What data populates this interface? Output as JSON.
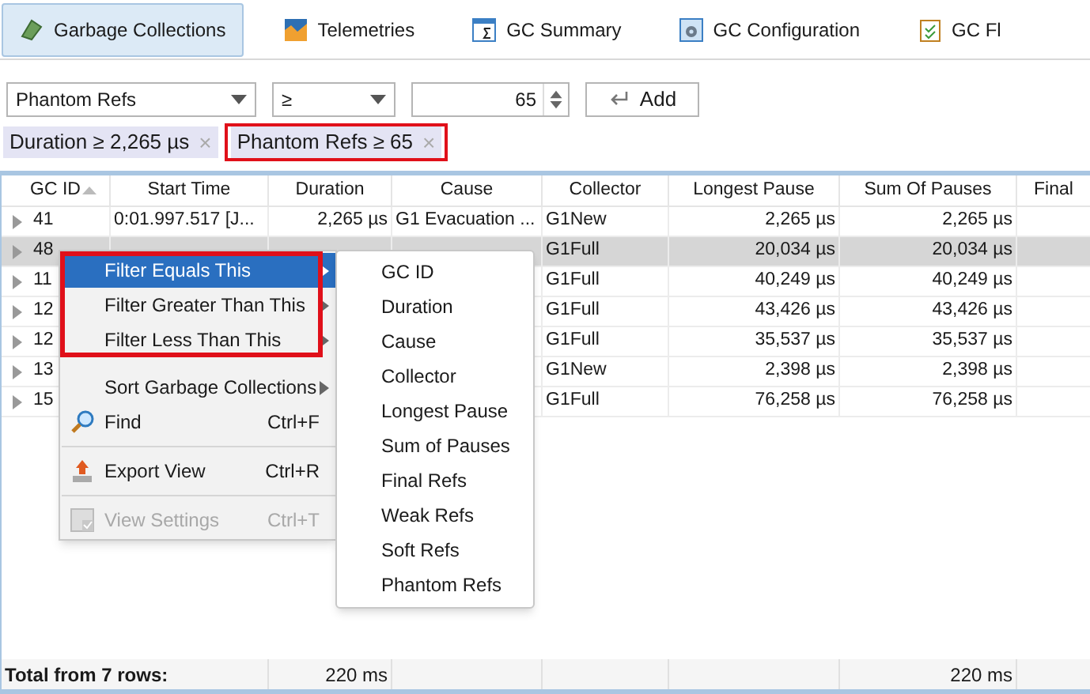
{
  "tabs": [
    {
      "label": "Garbage Collections",
      "selected": true
    },
    {
      "label": "Telemetries",
      "selected": false
    },
    {
      "label": "GC Summary",
      "selected": false
    },
    {
      "label": "GC Configuration",
      "selected": false
    },
    {
      "label": "GC Fl",
      "selected": false
    }
  ],
  "filter_bar": {
    "attribute": "Phantom Refs",
    "operator": "≥",
    "value": "65",
    "add_button": "Add"
  },
  "active_filters": [
    {
      "label": "Duration ≥ 2,265 µs",
      "close": "×",
      "highlighted": false
    },
    {
      "label": "Phantom Refs ≥ 65",
      "close": "×",
      "highlighted": true
    }
  ],
  "table": {
    "columns": [
      "GC ID",
      "Start Time",
      "Duration",
      "Cause",
      "Collector",
      "Longest Pause",
      "Sum Of Pauses",
      "Final"
    ],
    "rows": [
      {
        "cells": [
          "41",
          "0:01.997.517 [J...",
          "2,265 µs",
          "G1 Evacuation ...",
          "G1New",
          "2,265 µs",
          "2,265 µs"
        ],
        "selected": false
      },
      {
        "cells": [
          "48",
          "",
          "",
          "",
          "G1Full",
          "20,034 µs",
          "20,034 µs"
        ],
        "selected": true
      },
      {
        "cells": [
          "11",
          "",
          "",
          "",
          "G1Full",
          "40,249 µs",
          "40,249 µs"
        ],
        "selected": false
      },
      {
        "cells": [
          "12",
          "",
          "",
          "",
          "G1Full",
          "43,426 µs",
          "43,426 µs"
        ],
        "selected": false
      },
      {
        "cells": [
          "12",
          "",
          "",
          "",
          "G1Full",
          "35,537 µs",
          "35,537 µs"
        ],
        "selected": false
      },
      {
        "cells": [
          "13",
          "",
          "",
          "",
          "G1New",
          "2,398 µs",
          "2,398 µs"
        ],
        "selected": false
      },
      {
        "cells": [
          "15",
          "",
          "",
          "",
          "G1Full",
          "76,258 µs",
          "76,258 µs"
        ],
        "selected": false
      }
    ],
    "footer": {
      "label": "Total from 7 rows:",
      "duration": "220 ms",
      "sum_of_pauses": "220 ms"
    }
  },
  "context_menu": {
    "filter_group_highlighted": true,
    "items": [
      {
        "kind": "submenu",
        "label": "Filter Equals This",
        "selected": true
      },
      {
        "kind": "submenu",
        "label": "Filter Greater Than This",
        "selected": false
      },
      {
        "kind": "submenu",
        "label": "Filter Less Than This",
        "selected": false
      },
      {
        "kind": "gap"
      },
      {
        "kind": "submenu",
        "label": "Sort Garbage Collections",
        "selected": false
      },
      {
        "kind": "command",
        "label": "Find",
        "shortcut": "Ctrl+F",
        "disabled": false
      },
      {
        "kind": "separator"
      },
      {
        "kind": "command",
        "label": "Export View",
        "shortcut": "Ctrl+R",
        "disabled": false
      },
      {
        "kind": "separator"
      },
      {
        "kind": "command",
        "label": "View Settings",
        "shortcut": "Ctrl+T",
        "disabled": true
      }
    ]
  },
  "submenu": [
    "GC ID",
    "Duration",
    "Cause",
    "Collector",
    "Longest Pause",
    "Sum of Pauses",
    "Final Refs",
    "Weak Refs",
    "Soft Refs",
    "Phantom Refs"
  ]
}
